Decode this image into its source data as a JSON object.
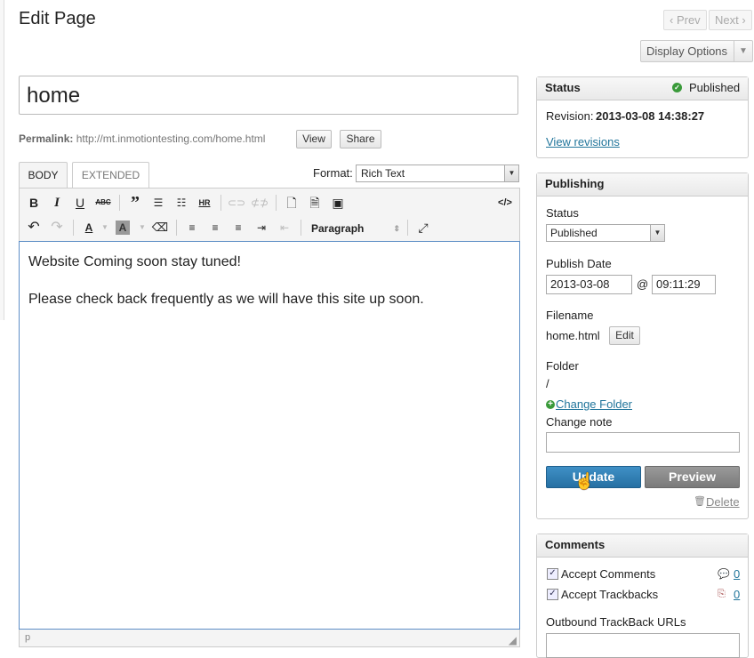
{
  "header": {
    "title": "Edit Page",
    "prev": "‹ Prev",
    "next": "Next ›",
    "display_options": "Display Options"
  },
  "title_field": {
    "value": "home"
  },
  "permalink": {
    "label": "Permalink:",
    "url": "http://mt.inmotiontesting.com/home.html",
    "view": "View",
    "share": "Share"
  },
  "tabs": [
    {
      "label": "BODY"
    },
    {
      "label": "EXTENDED"
    }
  ],
  "format": {
    "label": "Format:",
    "value": "Rich Text"
  },
  "toolbar": {
    "paragraph": "Paragraph"
  },
  "editor": {
    "lines": [
      "Website Coming soon stay tuned!",
      "Please check back frequently as we will have this site up soon."
    ],
    "path": "p"
  },
  "status_panel": {
    "title": "Status",
    "state": "Published",
    "revision_label": "Revision:",
    "revision": "2013-03-08 14:38:27",
    "view_revisions": "View revisions"
  },
  "publishing_panel": {
    "title": "Publishing",
    "status_label": "Status",
    "status_value": "Published",
    "date_label": "Publish Date",
    "date": "2013-03-08",
    "at": "@",
    "time": "09:11:29",
    "filename_label": "Filename",
    "filename": "home.html",
    "edit": "Edit",
    "folder_label": "Folder",
    "folder": "/",
    "change_folder": "Change Folder",
    "change_note_label": "Change note",
    "change_note": "",
    "update": "Update",
    "preview": "Preview",
    "delete": "Delete"
  },
  "comments_panel": {
    "title": "Comments",
    "accept_comments": "Accept Comments",
    "comments_count": "0",
    "accept_trackbacks": "Accept Trackbacks",
    "trackbacks_count": "0",
    "outbound_label": "Outbound TrackBack URLs"
  },
  "colors": {
    "accent": "#21759b",
    "update_btn": "#2e7fb5",
    "preview_btn": "#8a8a8a",
    "published_dot": "#3a9a3a",
    "editor_border": "#5e8ec6"
  }
}
